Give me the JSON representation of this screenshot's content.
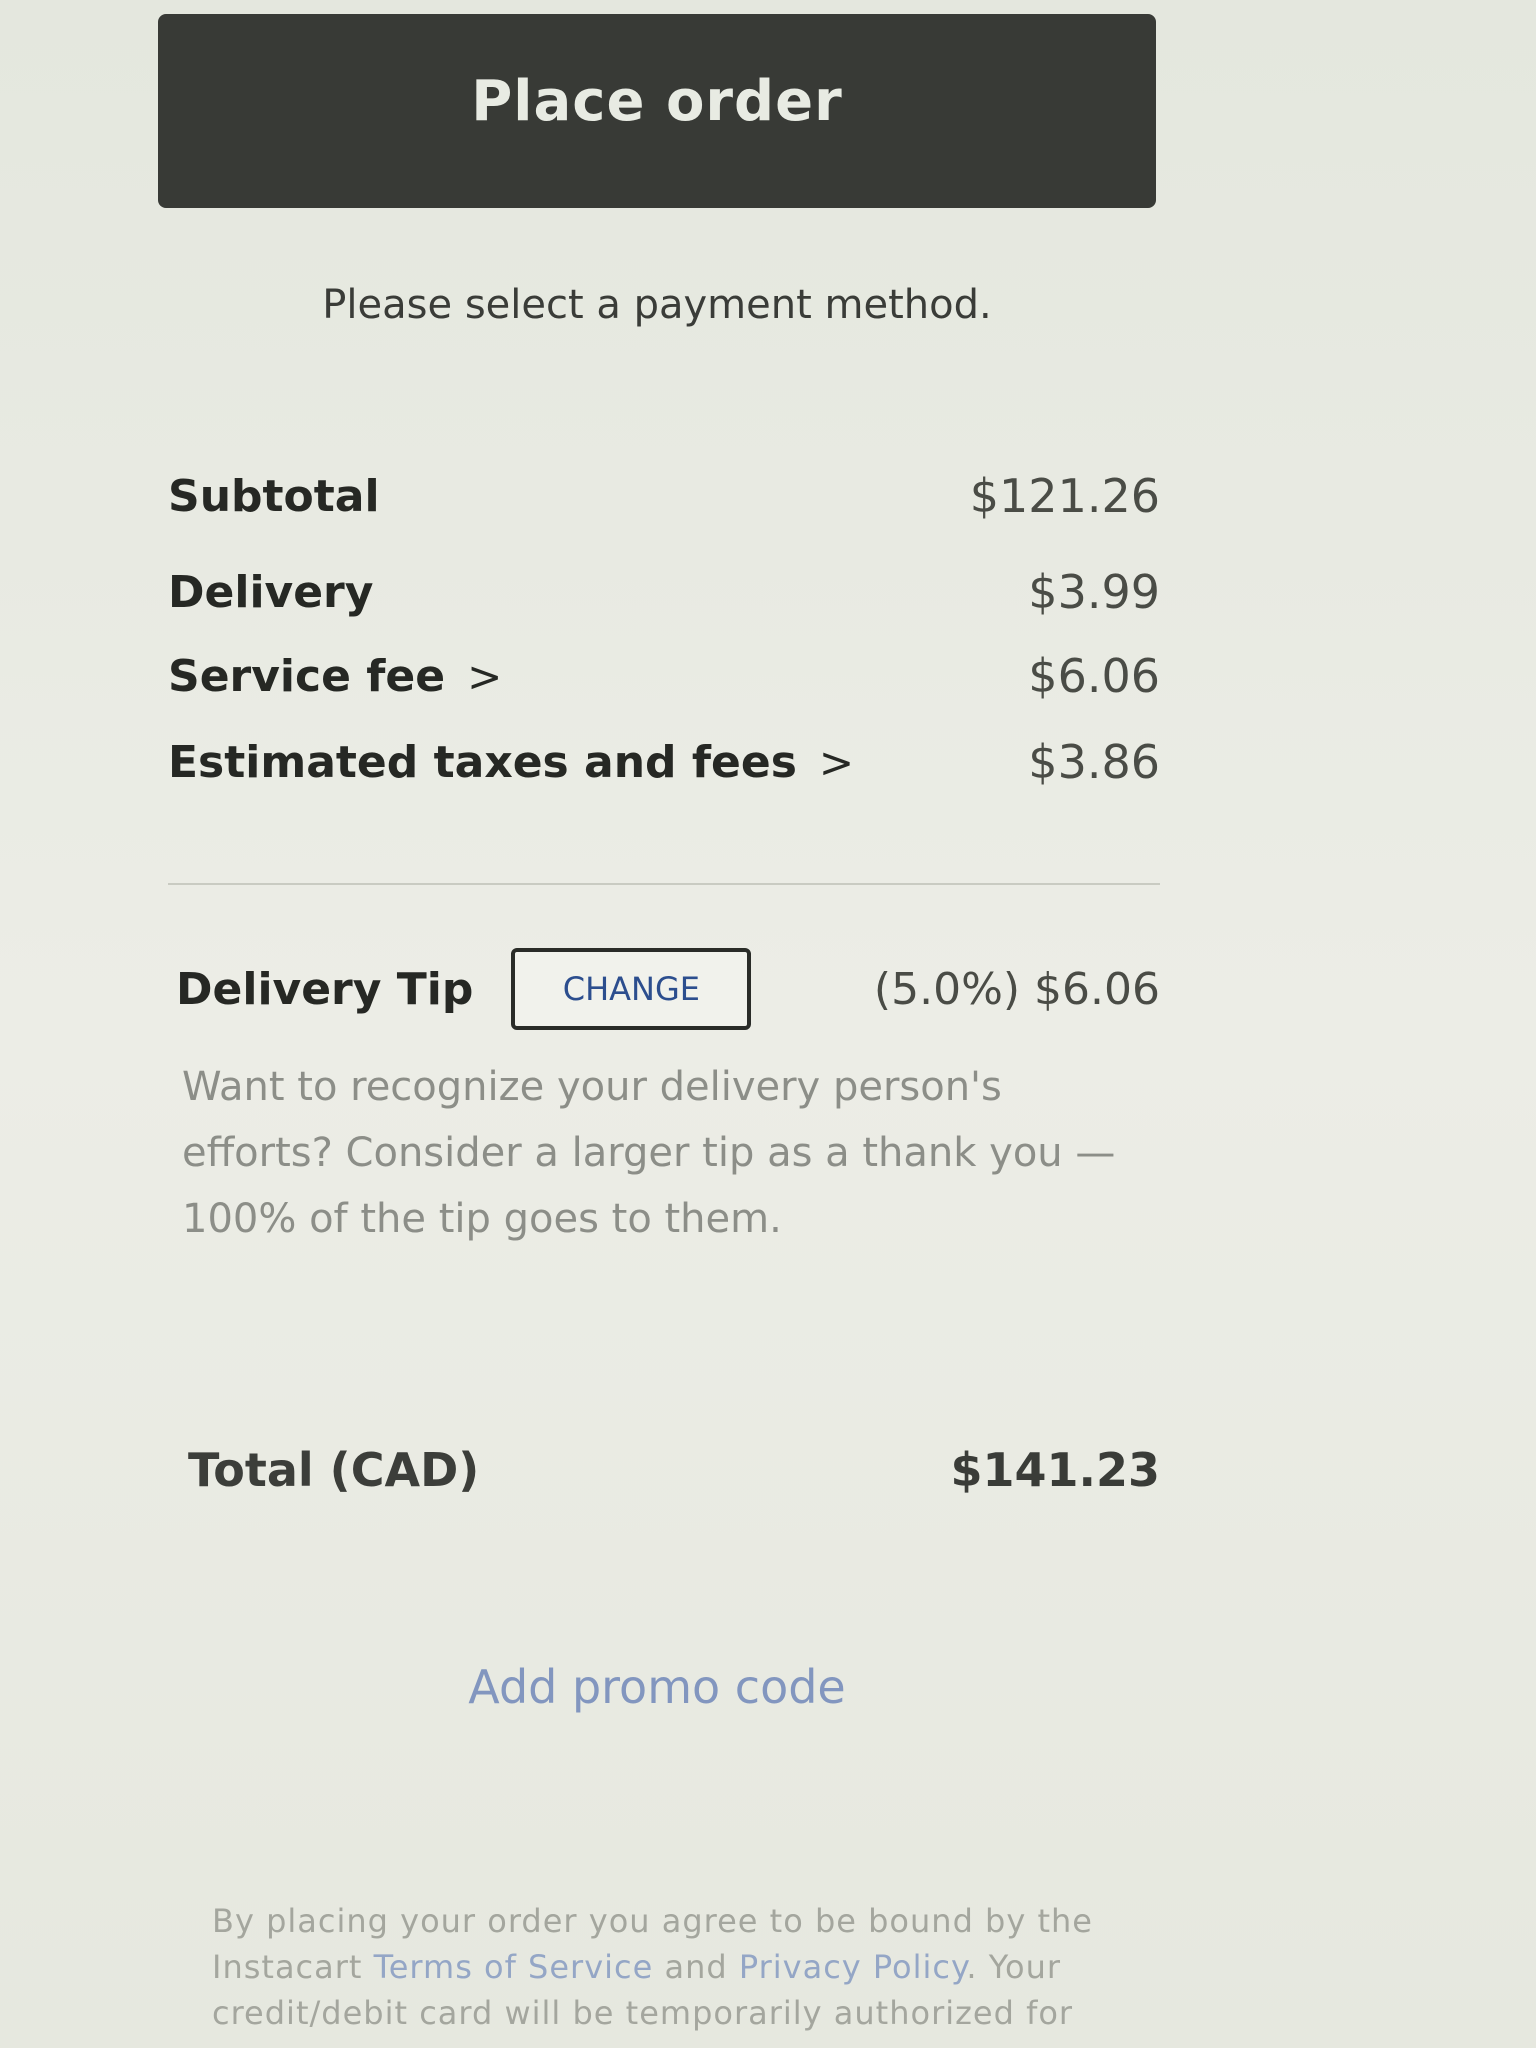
{
  "actions": {
    "place_order_label": "Place order",
    "payment_message": "Please select a payment method."
  },
  "fees": [
    {
      "label": "Subtotal",
      "value": "$121.26",
      "has_details": false
    },
    {
      "label": "Delivery",
      "value": "$3.99",
      "has_details": false
    },
    {
      "label": "Service fee",
      "value": "$6.06",
      "has_details": true
    },
    {
      "label": "Estimated taxes and fees",
      "value": "$3.86",
      "has_details": true
    }
  ],
  "chevron_glyph": ">",
  "tip": {
    "label": "Delivery Tip",
    "change_label": "CHANGE",
    "value": "(5.0%) $6.06",
    "note": "Want to recognize your delivery person's efforts? Consider a larger tip as a thank you — 100% of the tip goes to them."
  },
  "total": {
    "label": "Total (CAD)",
    "value": "$141.23"
  },
  "promo": {
    "label": "Add promo code"
  },
  "legal": {
    "prefix": "By placing your order you agree to be bound by the Instacart ",
    "terms_link": "Terms of Service",
    "and": " and ",
    "privacy_link": "Privacy Policy",
    "suffix": ". Your credit/debit card will be temporarily authorized for"
  },
  "colors": {
    "primary_button": "#383a36",
    "link": "#8296bf",
    "change_text": "#2c4e8e"
  },
  "icons": {
    "details_chevron": "chevron-right-icon"
  }
}
